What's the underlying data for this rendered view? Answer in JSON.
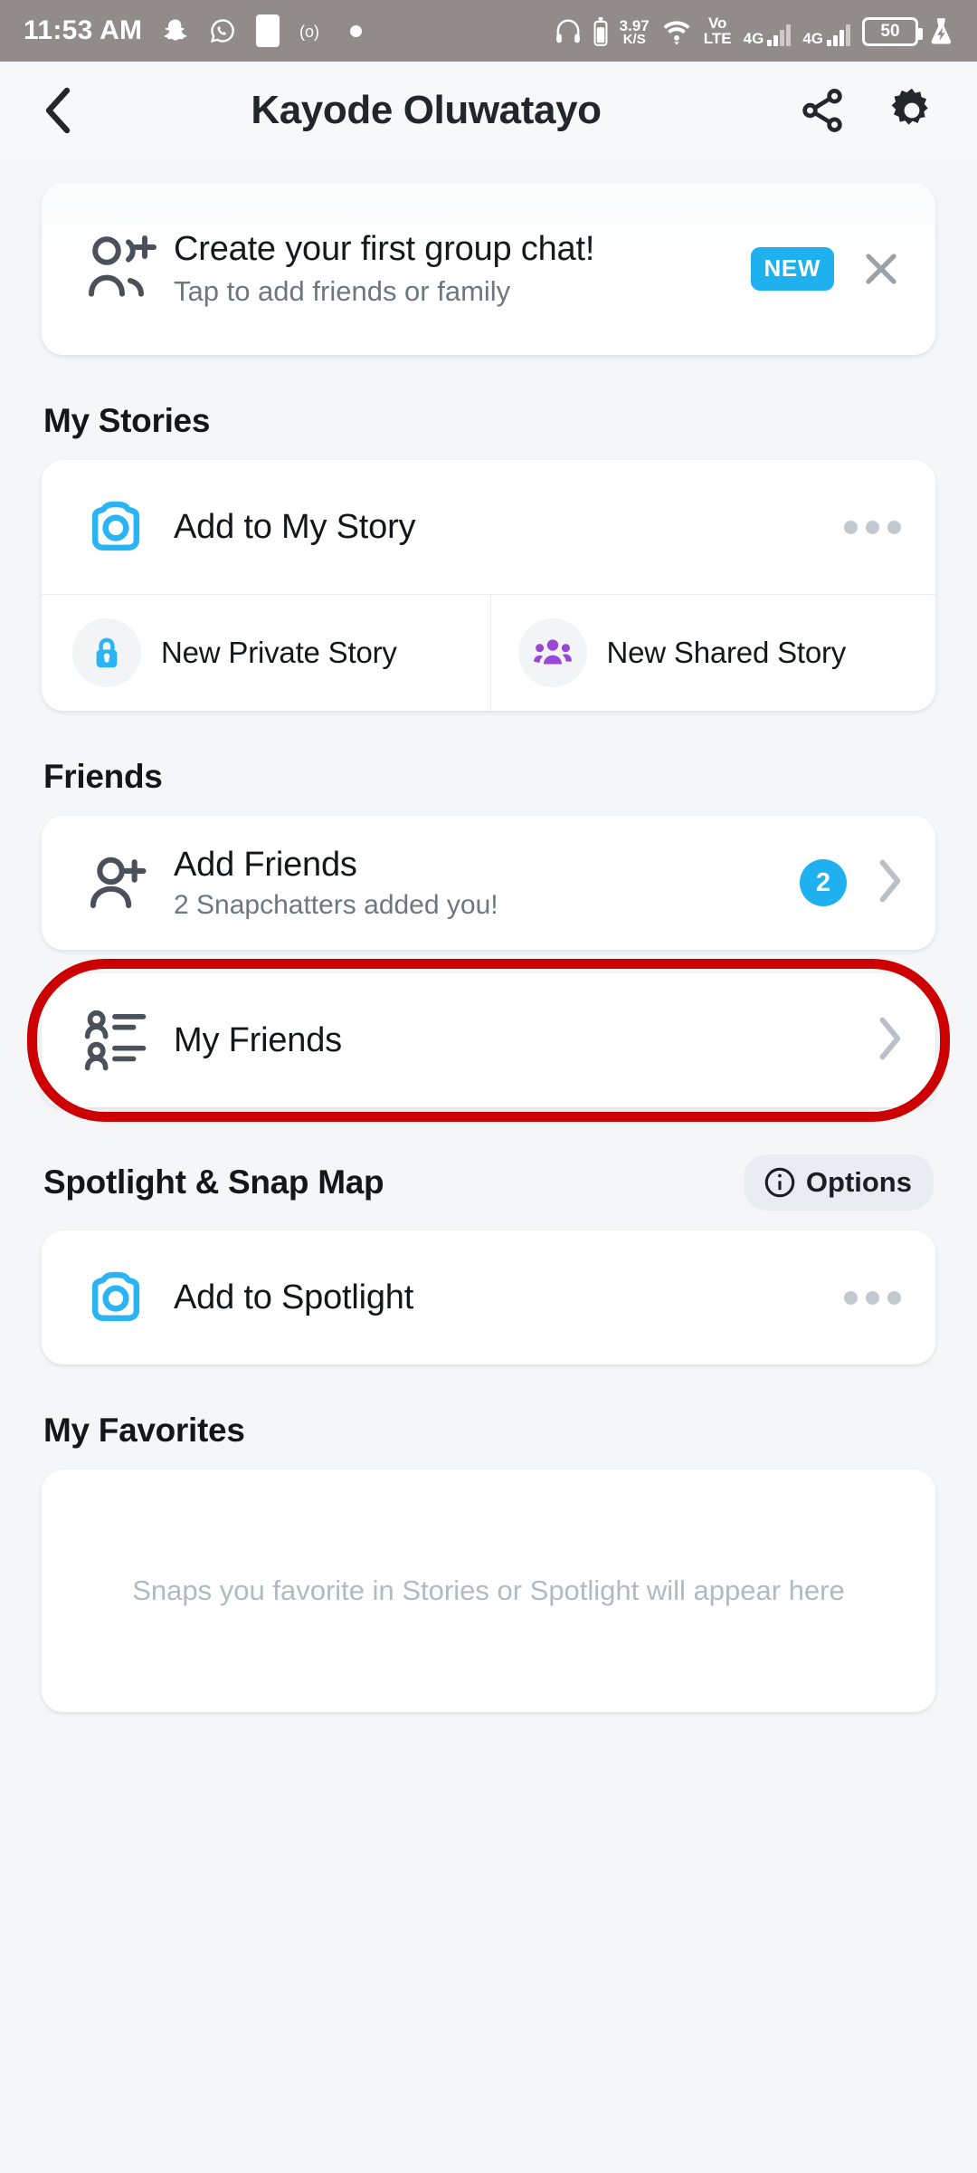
{
  "statusbar": {
    "time": "11:53 AM",
    "left_icons": [
      "snapchat-icon",
      "whatsapp-icon",
      "app-square-icon",
      "recording-icon",
      "dot-icon"
    ],
    "net_speed_value": "3.97",
    "net_speed_unit": "K/S",
    "volte_line1": "Vo",
    "volte_line2": "LTE",
    "sim1_network": "4G",
    "sim2_network": "4G",
    "battery_percent": "50",
    "right_icons": [
      "headphones-icon",
      "wifi-icon",
      "battery-icon",
      "charging-flask-icon"
    ]
  },
  "header": {
    "back_label": "‹",
    "title": "Kayode Oluwatayo",
    "share_label": "share-icon",
    "settings_label": "gear-icon"
  },
  "banner": {
    "icon": "group-add-icon",
    "title": "Create your first group chat!",
    "subtitle": "Tap to add friends or family",
    "badge": "NEW",
    "close": "×"
  },
  "sections": {
    "my_stories": {
      "title": "My Stories",
      "add_story": {
        "label": "Add to My Story",
        "icon": "camera-icon",
        "more": "ellipsis-icon"
      },
      "private_story": {
        "label": "New Private Story",
        "icon": "lock-icon"
      },
      "shared_story": {
        "label": "New Shared Story",
        "icon": "group-people-icon"
      }
    },
    "friends": {
      "title": "Friends",
      "add_friends": {
        "label": "Add Friends",
        "subtitle": "2 Snapchatters added you!",
        "icon": "add-person-icon",
        "badge_count": "2",
        "chevron": "›"
      },
      "my_friends": {
        "label": "My Friends",
        "icon": "friends-list-icon",
        "chevron": "›",
        "highlighted": true
      }
    },
    "spotlight": {
      "title": "Spotlight & Snap Map",
      "options_label": "Options",
      "options_icon": "info-icon",
      "add_spotlight": {
        "label": "Add to Spotlight",
        "icon": "camera-icon",
        "more": "ellipsis-icon"
      }
    },
    "favorites": {
      "title": "My Favorites",
      "empty_text": "Snaps you favorite in Stories or Spotlight will appear here"
    }
  },
  "colors": {
    "accent_blue": "#1fb0f0",
    "purple": "#9a46d6",
    "highlight_red": "#cc0000",
    "page_bg": "#f4f6f8",
    "statusbar_bg": "#918c89"
  }
}
